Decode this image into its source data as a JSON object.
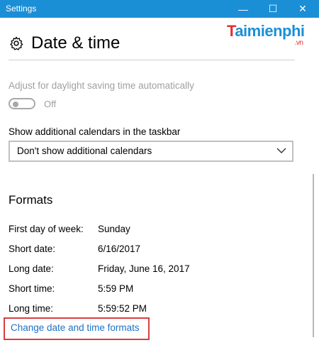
{
  "window": {
    "title": "Settings",
    "controls": {
      "minimize": "—",
      "maximize": "☐",
      "close": "✕"
    }
  },
  "logo": {
    "main_a": "T",
    "main_b": "aimienphi",
    "suffix": ".vn"
  },
  "header": {
    "title": "Date & time",
    "icon": "gear-icon"
  },
  "daylight": {
    "label": "Adjust for daylight saving time automatically",
    "toggle_state": "Off"
  },
  "calendars": {
    "label": "Show additional calendars in the taskbar",
    "selected": "Don't show additional calendars"
  },
  "formats": {
    "title": "Formats",
    "rows": [
      {
        "key": "First day of week:",
        "value": "Sunday"
      },
      {
        "key": "Short date:",
        "value": "6/16/2017"
      },
      {
        "key": "Long date:",
        "value": "Friday, June 16, 2017"
      },
      {
        "key": "Short time:",
        "value": "5:59 PM"
      },
      {
        "key": "Long time:",
        "value": "5:59:52 PM"
      }
    ],
    "link": "Change date and time formats"
  },
  "colors": {
    "titlebar": "#1b8fd6",
    "link": "#1b72c7",
    "highlight_box": "#d64040"
  }
}
